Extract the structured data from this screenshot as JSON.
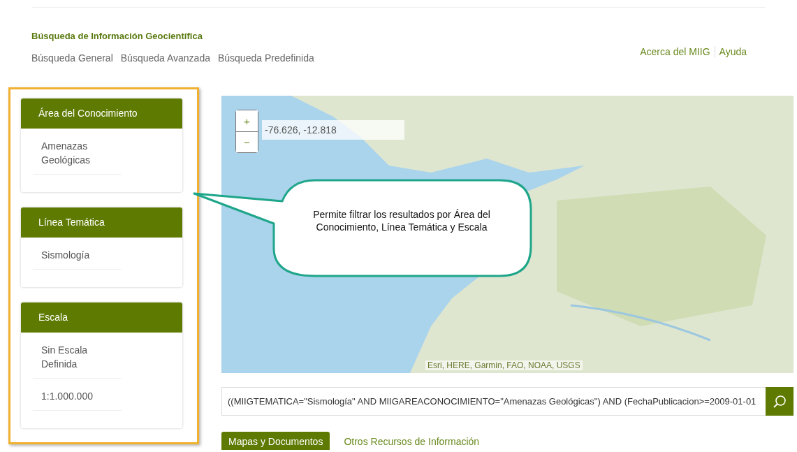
{
  "header": {
    "title": "Búsqueda de Información Geocientífica",
    "nav": [
      {
        "label": "Búsqueda General"
      },
      {
        "label": "Búsqueda Avanzada"
      },
      {
        "label": "Búsqueda Predefinida"
      }
    ],
    "links": [
      {
        "label": "Acerca del MIIG"
      },
      {
        "label": "Ayuda"
      }
    ]
  },
  "filters": [
    {
      "title": "Área del Conocimiento",
      "items": [
        "Amenazas Geológicas"
      ]
    },
    {
      "title": "Línea Temática",
      "items": [
        "Sismología"
      ]
    },
    {
      "title": "Escala",
      "items": [
        "Sin Escala Definida",
        "1:1.000.000"
      ]
    }
  ],
  "map": {
    "zoom_in": "+",
    "zoom_out": "−",
    "coordinates": "-76.626, -12.818",
    "attribution": "Esri, HERE, Garmin, FAO, NOAA, USGS"
  },
  "search": {
    "value": "((MIIGTEMATICA=\"Sismología\" AND MIIGAREACONOCIMIENTO=\"Amenazas Geológicas\") AND (FechaPublicacion>=2009-01-01"
  },
  "result_tabs": [
    {
      "label": "Mapas y Documentos",
      "selected": true
    },
    {
      "label": "Otros Recursos de Información",
      "selected": false
    }
  ],
  "callout": {
    "text": "Permite filtrar los resultados por Área del Conocimiento, Línea Temática y Escala"
  }
}
